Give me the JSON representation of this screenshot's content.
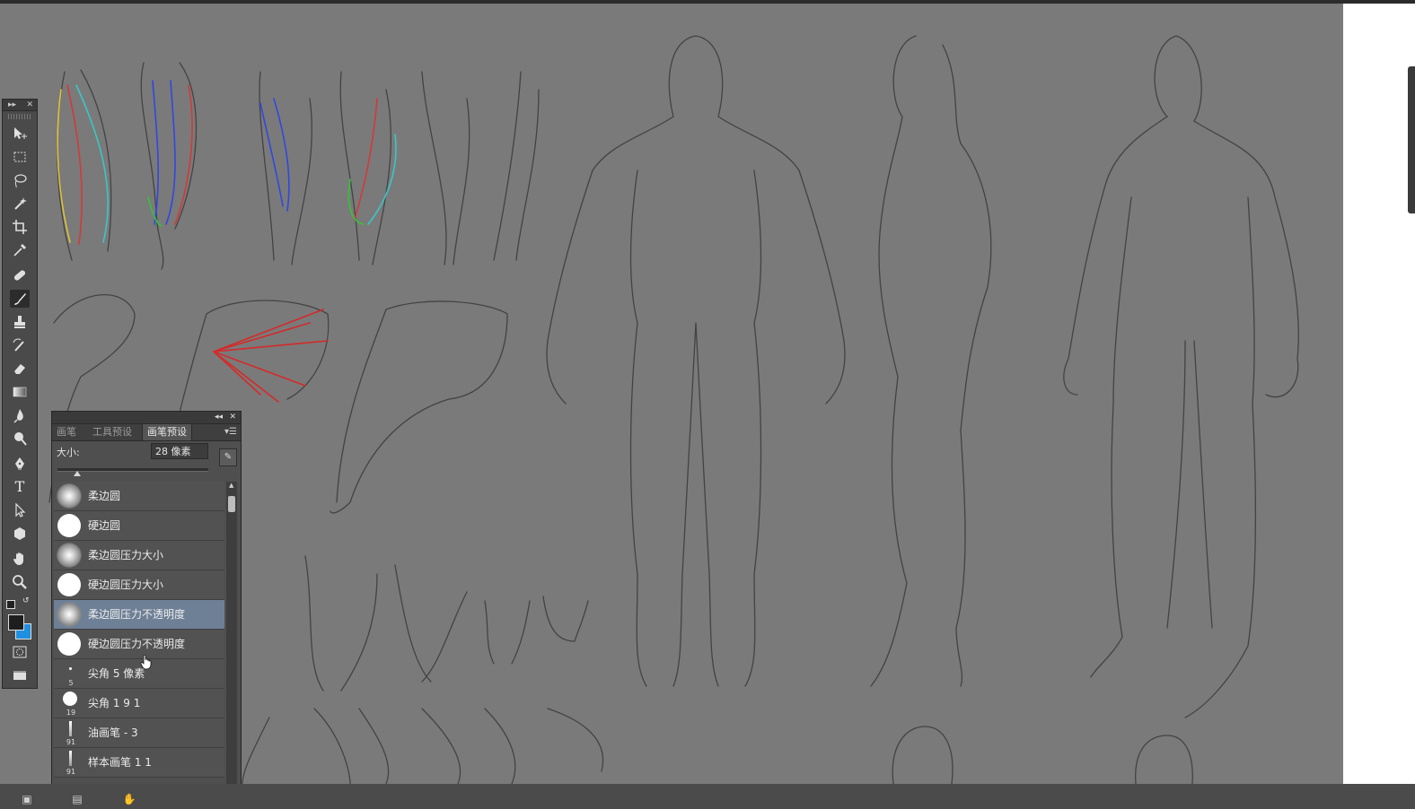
{
  "app": {
    "accent_color": "#6e8096",
    "canvas_color": "#7a7a7a",
    "panel_color": "#4f4f4f"
  },
  "toolbox": {
    "tools": [
      {
        "name": "move-tool-icon"
      },
      {
        "name": "rect-marquee-icon"
      },
      {
        "name": "lasso-icon"
      },
      {
        "name": "magic-wand-icon"
      },
      {
        "name": "crop-icon"
      },
      {
        "name": "eyedropper-icon"
      },
      {
        "name": "healing-brush-icon"
      },
      {
        "name": "brush-icon",
        "active": true
      },
      {
        "name": "clone-stamp-icon"
      },
      {
        "name": "history-brush-icon"
      },
      {
        "name": "eraser-icon"
      },
      {
        "name": "gradient-icon"
      },
      {
        "name": "blur-icon"
      },
      {
        "name": "dodge-icon"
      },
      {
        "name": "pen-icon"
      },
      {
        "name": "type-icon"
      },
      {
        "name": "path-select-icon"
      },
      {
        "name": "shape-icon"
      },
      {
        "name": "hand-icon"
      },
      {
        "name": "zoom-icon"
      }
    ],
    "type_glyph": "T",
    "foreground_color": "#1e1e1e",
    "background_color": "#1f8fdf"
  },
  "brush_panel": {
    "tabs": [
      "画笔",
      "工具预设",
      "画笔预设"
    ],
    "active_tab": "画笔预设",
    "size_label": "大小:",
    "size_value": "28 像素",
    "brushes": [
      {
        "name": "柔边圆",
        "kind": "soft"
      },
      {
        "name": "硬边圆",
        "kind": "hard"
      },
      {
        "name": "柔边圆压力大小",
        "kind": "soft"
      },
      {
        "name": "硬边圆压力大小",
        "kind": "hard"
      },
      {
        "name": "柔边圆压力不透明度",
        "kind": "soft",
        "selected": true
      },
      {
        "name": "硬边圆压力不透明度",
        "kind": "hard"
      },
      {
        "name": "尖角 5 像素",
        "kind": "dot",
        "size": "5"
      },
      {
        "name": "尖角 1 9 1",
        "kind": "dot-large",
        "size": "19"
      },
      {
        "name": "油画笔 - 3",
        "kind": "stroke",
        "size": "91"
      },
      {
        "name": "样本画笔 1 1",
        "kind": "stroke",
        "size": "91"
      }
    ]
  }
}
